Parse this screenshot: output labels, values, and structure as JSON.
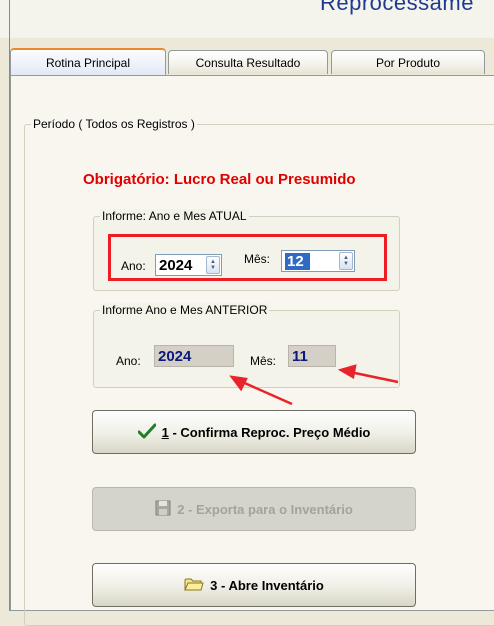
{
  "window": {
    "title": "Reprocessame"
  },
  "tabs": [
    {
      "label": "Rotina Principal",
      "active": true
    },
    {
      "label": "Consulta Resultado",
      "active": false
    },
    {
      "label": "Por Produto",
      "active": false
    }
  ],
  "period_group": {
    "legend": "Período ( Todos os Registros )"
  },
  "required_notice": "Obrigatório: Lucro Real ou Presumido",
  "current_group": {
    "legend": "Informe: Ano e Mes ATUAL",
    "year_label": "Ano:",
    "year_value": "2024",
    "month_label": "Mês:",
    "month_value": "12"
  },
  "previous_group": {
    "legend": "Informe Ano e Mes ANTERIOR",
    "year_label": "Ano:",
    "year_value": "2024",
    "month_label": "Mês:",
    "month_value": "11"
  },
  "buttons": {
    "confirm": {
      "hotkey": "1",
      "label": " - Confirma Reproc. Preço Médio",
      "icon": "checkmark-icon",
      "enabled": true
    },
    "export": {
      "label": "2 - Exporta para o Inventário",
      "icon": "floppy-disk-icon",
      "enabled": false
    },
    "open": {
      "label": "3 - Abre Inventário",
      "icon": "folder-icon",
      "enabled": true
    }
  },
  "colors": {
    "notice_red": "#e00000",
    "highlight_frame": "#ee1c24",
    "selection_blue": "#316ac5",
    "readonly_text": "#0a1a7a"
  }
}
